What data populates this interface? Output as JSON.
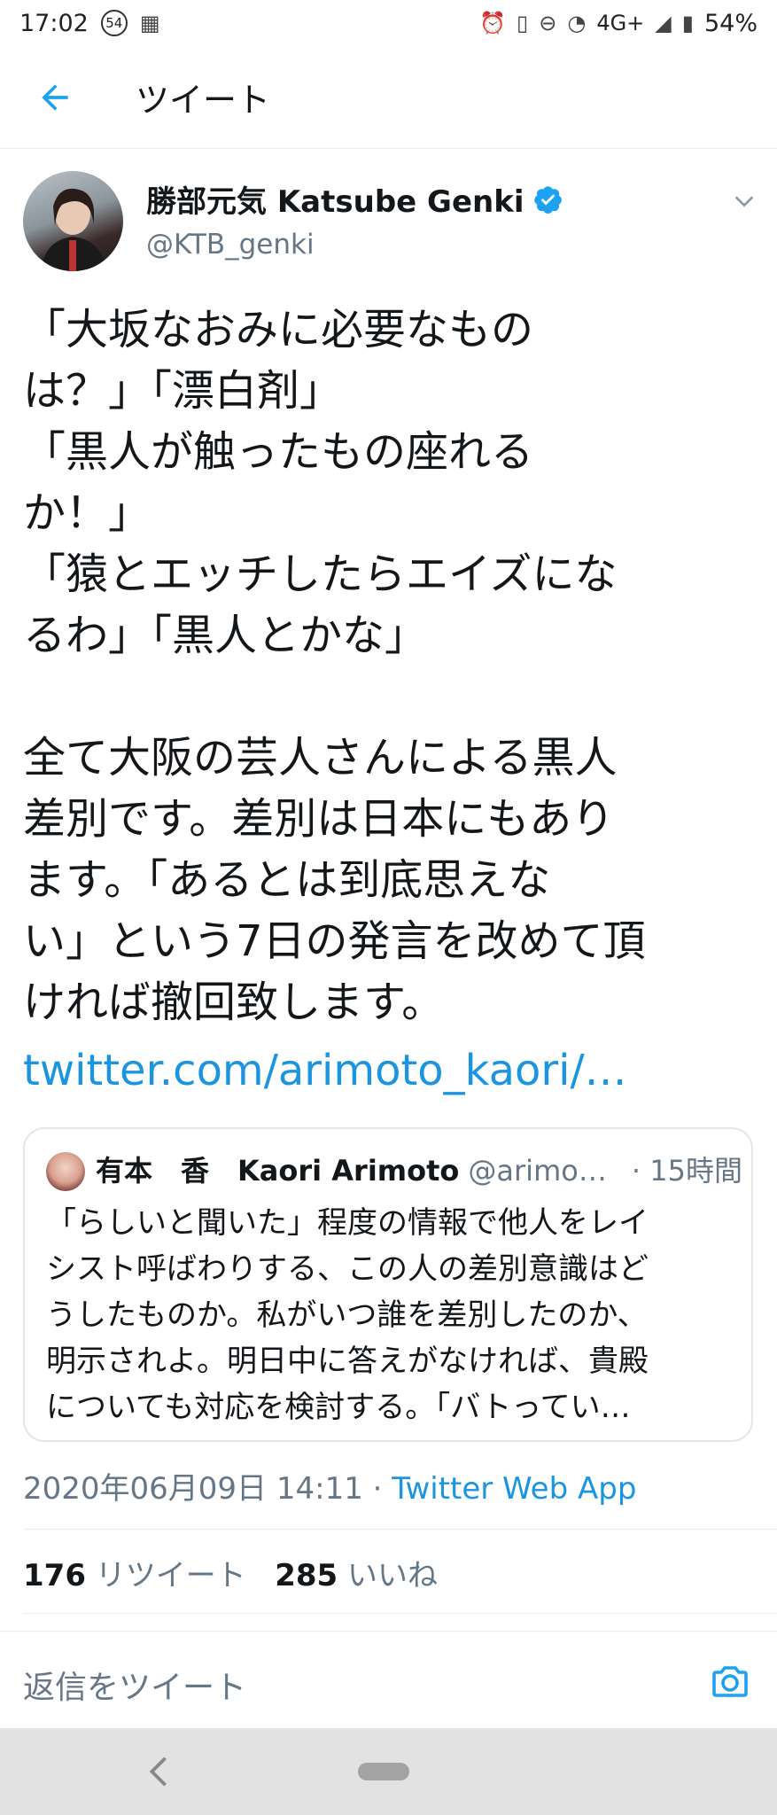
{
  "status_bar": {
    "time": "17:02",
    "notification_count": "54",
    "network": "4G+",
    "battery": "54%"
  },
  "header": {
    "title": "ツイート"
  },
  "tweet": {
    "author_name": "勝部元気 Katsube Genki",
    "author_handle": "@KTB_genki",
    "text": "「大坂なおみに必要なもの\nは？」「漂白剤」\n「黒人が触ったもの座れる\nか！」\n「猿とエッチしたらエイズにな\nるわ」「黒人とかな」\n\n全て大阪の芸人さんによる黒人\n差別です。差別は日本にもあり\nます。「あるとは到底思えな\nい」という7日の発言を改めて頂\nければ撤回致します。",
    "link": "twitter.com/arimoto_kaori/…",
    "timestamp": "2020年06月09日 14:11",
    "separator": " · ",
    "source": "Twitter Web App",
    "retweet_count": "176",
    "retweet_label": "リツイート",
    "like_count": "285",
    "like_label": "いいね"
  },
  "quote": {
    "name": "有本　香　Kaori Arimoto",
    "handle": "@arimo…",
    "time": "· 15時間",
    "text": "「らしいと聞いた」程度の情報で他人をレイ\nシスト呼ばわりする、この人の差別意識はど\nうしたものか。私がいつ誰を差別したのか、\n明示されよ。明日中に答えがなければ、貴殿\nについても対応を検討する。「バトってい…"
  },
  "reply": {
    "placeholder": "返信をツイート"
  },
  "colors": {
    "accent": "#1da1f2",
    "link": "#1b95e0",
    "secondary_text": "#657786"
  }
}
